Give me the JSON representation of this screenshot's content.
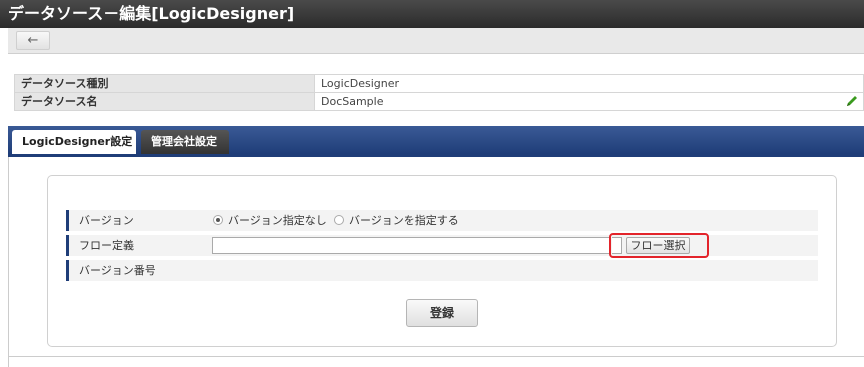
{
  "window": {
    "title": "データソース－編集[LogicDesigner]"
  },
  "toolbar": {
    "back_icon": "←"
  },
  "info": {
    "rows": [
      {
        "label": "データソース種別",
        "value": "LogicDesigner"
      },
      {
        "label": "データソース名",
        "value": "DocSample"
      }
    ],
    "edit_icon": "pencil-icon"
  },
  "tabs": [
    {
      "label": "LogicDesigner設定",
      "active": true
    },
    {
      "label": "管理会社設定",
      "active": false
    }
  ],
  "form": {
    "version_label": "バージョン",
    "version_options": [
      {
        "label": "バージョン指定なし",
        "selected": true
      },
      {
        "label": "バージョンを指定する",
        "selected": false
      }
    ],
    "flow_label": "フロー定義",
    "flow_value": "",
    "flow_button": "フロー選択",
    "version_number_label": "バージョン番号",
    "submit_label": "登録"
  },
  "colors": {
    "accent": "#1f3d78",
    "highlight": "#e3242b",
    "edit_icon": "#3a9a1e"
  }
}
